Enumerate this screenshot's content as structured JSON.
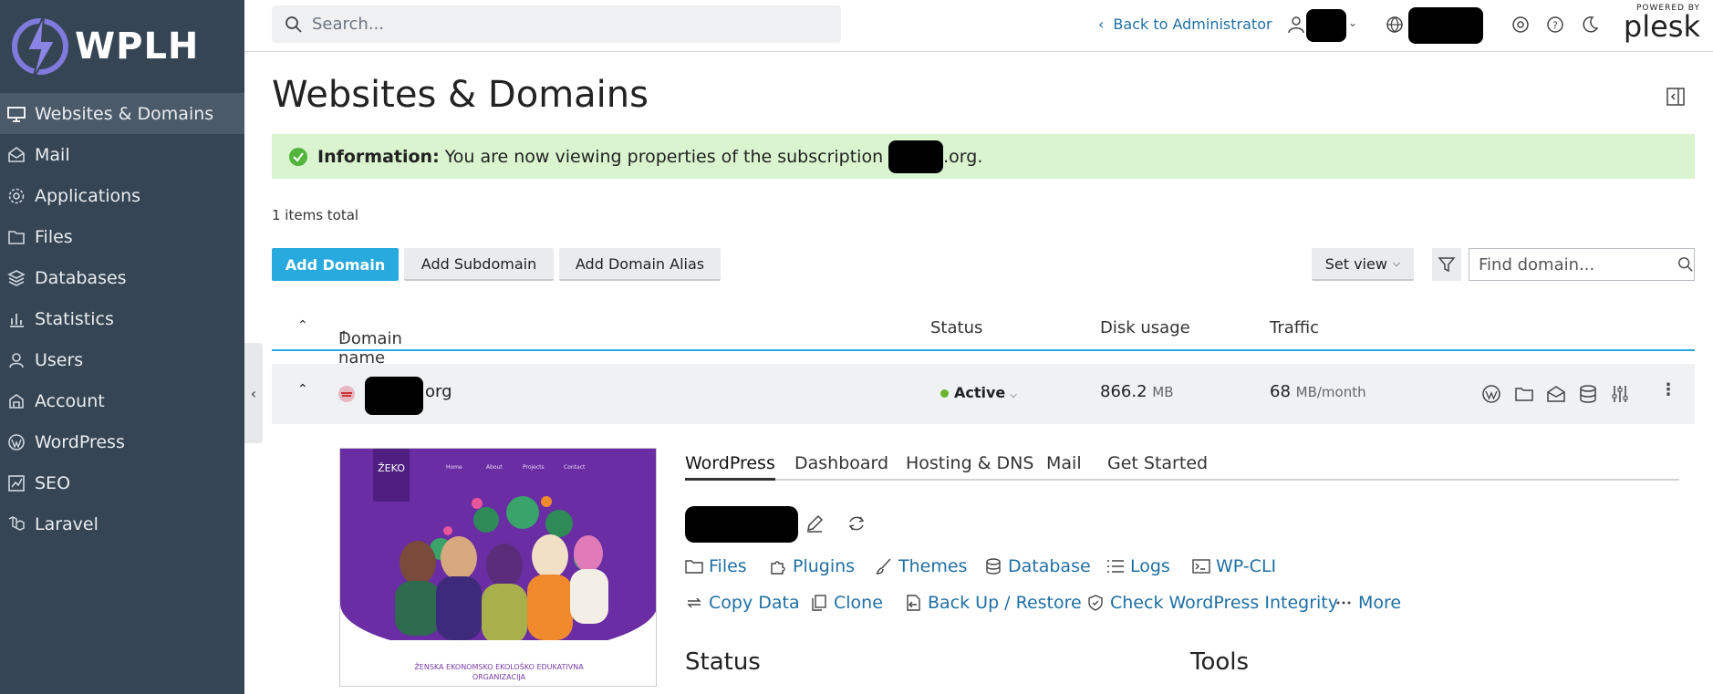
{
  "brand": {
    "logo_text": "WPLH"
  },
  "sidebar": {
    "items": [
      {
        "label": "Websites & Domains",
        "icon": "monitor-icon",
        "active": true
      },
      {
        "label": "Mail",
        "icon": "mail-icon"
      },
      {
        "label": "Applications",
        "icon": "gear-icon"
      },
      {
        "label": "Files",
        "icon": "folder-icon"
      },
      {
        "label": "Databases",
        "icon": "layers-icon"
      },
      {
        "label": "Statistics",
        "icon": "bar-chart-icon"
      },
      {
        "label": "Users",
        "icon": "user-icon"
      },
      {
        "label": "Account",
        "icon": "account-icon"
      },
      {
        "label": "WordPress",
        "icon": "wordpress-icon"
      },
      {
        "label": "SEO",
        "icon": "seo-icon"
      },
      {
        "label": "Laravel",
        "icon": "laravel-icon"
      }
    ]
  },
  "header": {
    "search_placeholder": "Search...",
    "back_link": "Back to Administrator",
    "powered_by": "POWERED BY",
    "plesk": "plesk"
  },
  "page": {
    "title": "Websites & Domains",
    "info_label": "Information:",
    "info_text": "You are now viewing properties of the subscription",
    "info_domain_suffix": ".org.",
    "items_total": "1 items total"
  },
  "toolbar": {
    "add_domain": "Add Domain",
    "add_subdomain": "Add Subdomain",
    "add_alias": "Add Domain Alias",
    "set_view": "Set view",
    "find_placeholder": "Find domain..."
  },
  "table": {
    "headers": {
      "name": "Domain name",
      "status": "Status",
      "disk": "Disk usage",
      "traffic": "Traffic"
    },
    "row": {
      "domain_suffix": "org",
      "status": "Active",
      "disk_value": "866.2",
      "disk_unit": "MB",
      "traffic_value": "68",
      "traffic_unit": "MB/month"
    }
  },
  "preview": {
    "site_logo": "ŽEKO",
    "nav_items": [
      "Home",
      "About",
      "Projects",
      "Contact"
    ],
    "footer_line1": "ŽENSKA EKONOMSKO EKOLOŠKO EDUKATIVNA",
    "footer_line2": "ORGANIZACIJA"
  },
  "detail": {
    "tabs": [
      "WordPress",
      "Dashboard",
      "Hosting & DNS",
      "Mail",
      "Get Started"
    ],
    "links_row1": [
      {
        "label": "Files",
        "icon": "folder-icon"
      },
      {
        "label": "Plugins",
        "icon": "puzzle-icon"
      },
      {
        "label": "Themes",
        "icon": "brush-icon"
      },
      {
        "label": "Database",
        "icon": "database-icon"
      },
      {
        "label": "Logs",
        "icon": "list-icon"
      },
      {
        "label": "WP-CLI",
        "icon": "terminal-icon"
      }
    ],
    "links_row2": [
      {
        "label": "Copy Data",
        "icon": "sync-icon"
      },
      {
        "label": "Clone",
        "icon": "copy-icon"
      },
      {
        "label": "Back Up / Restore",
        "icon": "backup-icon"
      },
      {
        "label": "Check WordPress Integrity",
        "icon": "shield-icon"
      },
      {
        "label": "More",
        "icon": "dots-icon"
      }
    ],
    "status_heading": "Status",
    "tools_heading": "Tools"
  },
  "colors": {
    "sidebar": "#364554",
    "accent": "#28aade",
    "link": "#1f6fa3",
    "info_bg": "#d9f4cf",
    "active_dot": "#6ab42d"
  }
}
